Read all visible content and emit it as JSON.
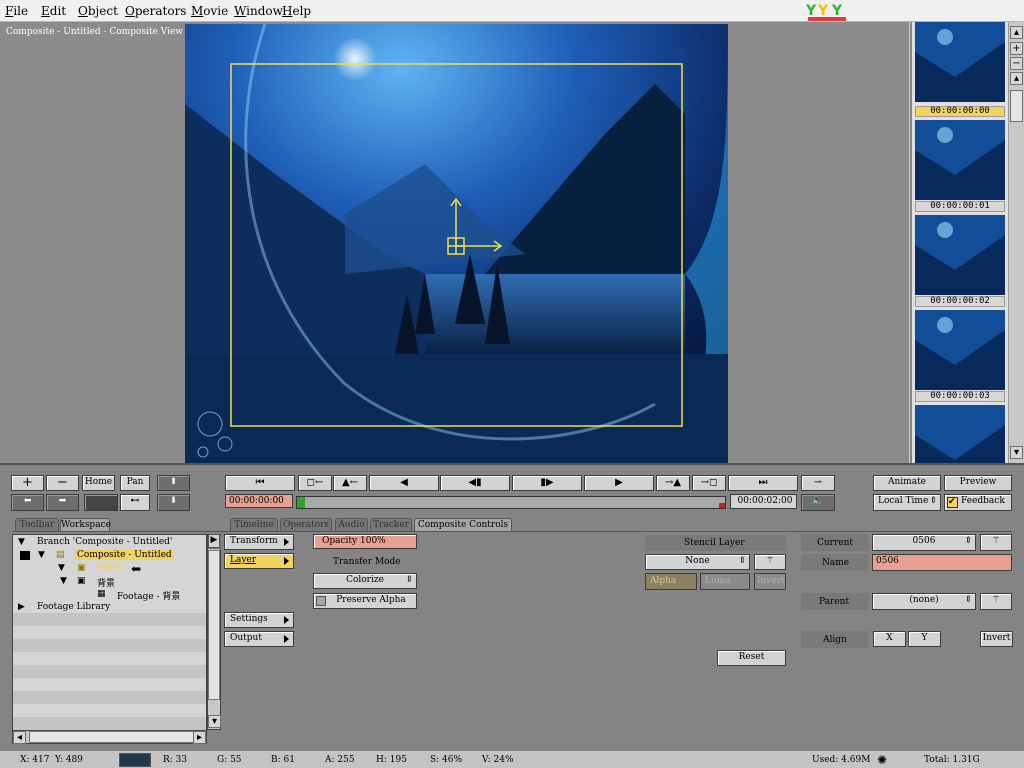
{
  "menu": [
    "File",
    "Edit",
    "Object",
    "Operators",
    "Movie",
    "Window",
    "Help"
  ],
  "viewer": {
    "title": "Composite - Untitled - Composite View (Normal, 70.66%, 8 Bit)"
  },
  "thumbnails": [
    "00:00:00:00",
    "00:00:00:01",
    "00:00:00:02",
    "00:00:00:03"
  ],
  "nav_buttons": {
    "plus": "+",
    "minus": "−",
    "home": "Home",
    "pan": "Pan"
  },
  "transport": {
    "start_time": "00:00:00:00",
    "end_time": "00:00:02:00"
  },
  "right_top": {
    "animate": "Animate",
    "preview": "Preview",
    "local_time": "Local Time",
    "feedback": "Feedback"
  },
  "tabs": [
    "Toolbar",
    "Workspace",
    "Timeline",
    "Operators",
    "Audio",
    "Tracker",
    "Composite Controls"
  ],
  "tree": {
    "branch": "Branch 'Composite - Untitled'",
    "composite": "Composite - Untitled",
    "layer": "0506",
    "child": "背景",
    "footage": "Footage - 背景",
    "library": "Footage Library"
  },
  "controls": {
    "transform": "Transform",
    "layer": "Layer",
    "settings": "Settings",
    "output": "Output",
    "opacity": "Opacity 100%",
    "transfer_mode": "Transfer Mode",
    "colorize": "Colorize",
    "preserve_alpha": "Preserve Alpha",
    "stencil_layer": "Stencil Layer",
    "stencil_value": "None",
    "alpha": "Alpha",
    "luma": "Luma",
    "invert": "Invert",
    "reset": "Reset"
  },
  "props": {
    "current_label": "Current",
    "current_value": "0506",
    "name_label": "Name",
    "name_value": "0506",
    "parent_label": "Parent",
    "parent_value": "(none)",
    "align_label": "Align",
    "align_x": "X",
    "align_y": "Y",
    "invert": "Invert"
  },
  "status": {
    "x": "X:  417",
    "y": "Y:  489",
    "r": "R: 33",
    "g": "G: 55",
    "b": "B: 61",
    "a": "A: 255",
    "h": "H: 195",
    "s": "S: 46%",
    "v": "V: 24%",
    "used": "Used: 4.69M",
    "total": "Total: 1.31G",
    "swatch_color": "#21384a"
  }
}
